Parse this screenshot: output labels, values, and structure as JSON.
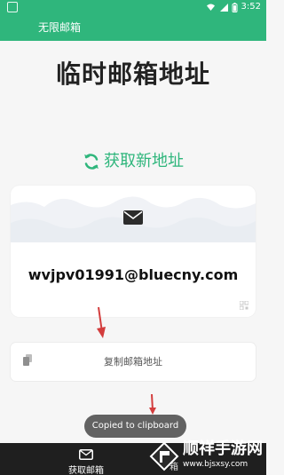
{
  "status": {
    "time": "3:52"
  },
  "app": {
    "title": "无限邮箱"
  },
  "page": {
    "title": "临时邮箱地址"
  },
  "refresh": {
    "label": "获取新地址"
  },
  "email": {
    "address": "wvjpv01991@bluecny.com"
  },
  "copy": {
    "label": "复制邮箱地址"
  },
  "toast": {
    "text": "Copied to clipboard"
  },
  "bottom_nav": {
    "item_label": "获取邮箱",
    "right_partial_label": "箱"
  },
  "watermark": {
    "brand": "顺祥手游网",
    "url": "www.bjsxsy.com"
  },
  "colors": {
    "accent": "#2fb67c",
    "arrow": "#d33d3d",
    "background": "#f6f6f6",
    "nav": "#1f1f1f"
  },
  "icons": {
    "refresh": "refresh-icon",
    "mail": "mail-icon",
    "qr": "qr-icon",
    "copy": "copy-icon",
    "nav": "mail-outline-icon"
  }
}
